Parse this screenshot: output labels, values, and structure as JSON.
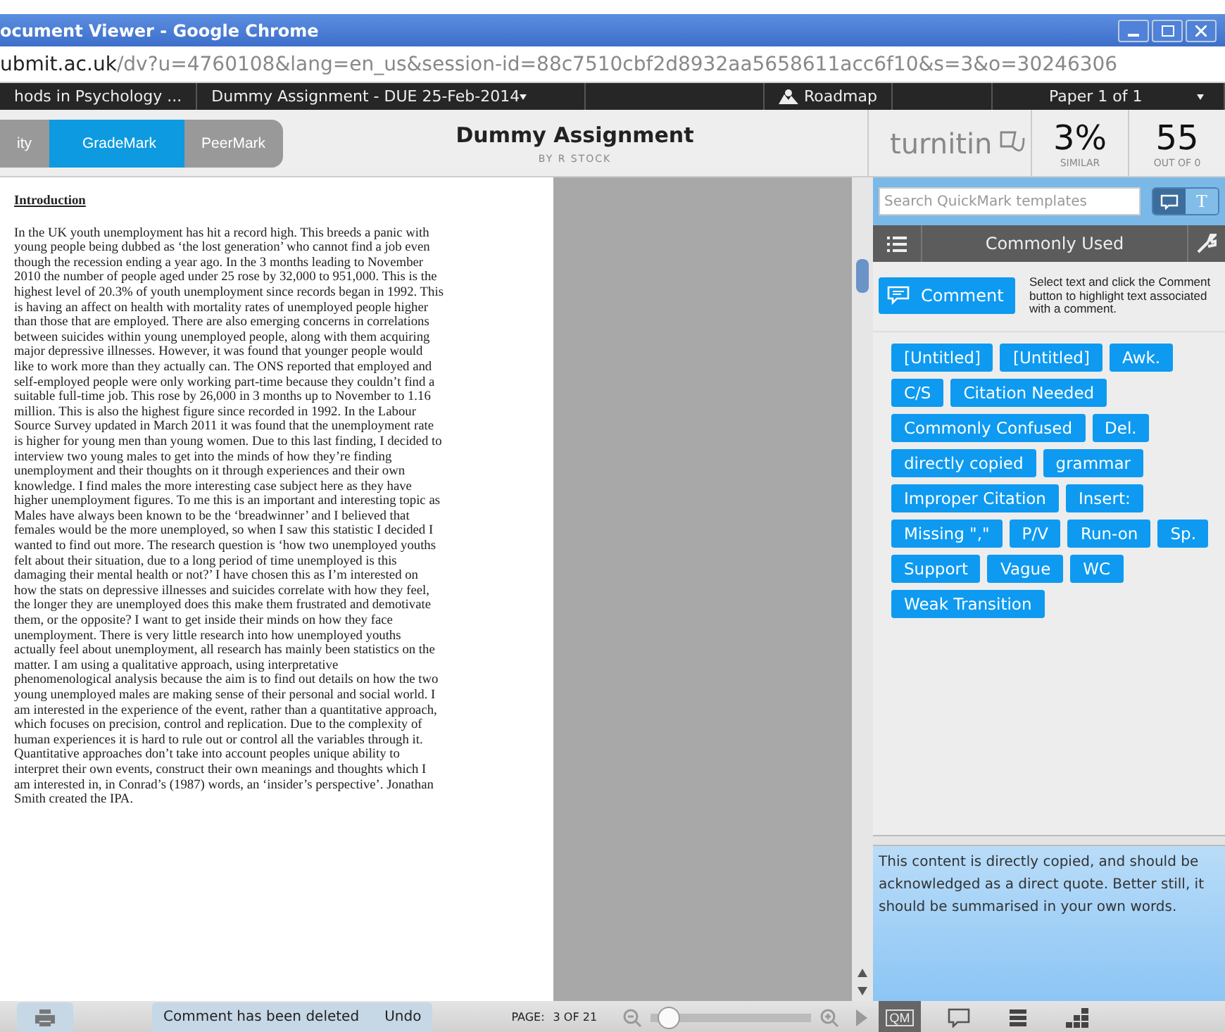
{
  "window": {
    "title": "ocument Viewer - Google Chrome"
  },
  "address": {
    "host": "ubmit.ac.uk",
    "path": "/dv?u=4760108&lang=en_us&session-id=88c7510cbf2d8932aa5658611acc6f10&s=3&o=30246306"
  },
  "nav": {
    "class": "hods in Psychology ...",
    "assignment": "Dummy Assignment - DUE 25-Feb-2014",
    "roadmap": "Roadmap",
    "paper": "Paper 1 of 1"
  },
  "modes": [
    {
      "label": "ity",
      "selected": false
    },
    {
      "label": "GradeMark",
      "selected": true
    },
    {
      "label": "PeerMark",
      "selected": false
    }
  ],
  "header": {
    "title": "Dummy Assignment",
    "author": "BY R STOCK",
    "brand": "turnitin",
    "similarity": "3%",
    "similarity_label": "SIMILAR",
    "score": "55",
    "score_label": "OUT OF 0"
  },
  "document": {
    "heading": "Introduction",
    "lines": [
      "In the UK youth unemployment has hit a record high. This breeds a panic with",
      "young people being dubbed as ‘the lost generation’ who cannot find a job even",
      "though the recession ending a year ago.  In the 3 months leading to November",
      "2010 the number of people aged under 25 rose by 32,000 to 951,000. This is the",
      "highest level of 20.3% of youth unemployment since records began in 1992. This",
      "is having an affect on health with mortality rates of unemployed people higher",
      "than those that are employed. There are also emerging concerns in correlations",
      "between suicides within young unemployed people, along with them acquiring",
      "major depressive illnesses. However, it was found that younger people would",
      "like to work more than they actually can. The ONS reported that employed and",
      "self-employed people were only working part-time because they couldn’t find a",
      "suitable full-time job. This rose by 26,000 in 3 months up to November to 1.16",
      "million. This is also the highest figure since recorded in 1992. In the Labour",
      "Source Survey updated in March 2011 it was found that the unemployment rate",
      "is higher for young men than young women. Due to this last finding, I decided to",
      "interview two young males to get into the minds of how they’re finding",
      "unemployment and their thoughts on it through experiences and their own",
      "knowledge. I find males the more interesting case subject here as they have",
      "higher unemployment figures. To me this is an important and interesting topic as",
      "Males have always been known to be the ‘breadwinner’ and I believed that",
      "females would be the more unemployed, so when I saw this statistic I decided I",
      "wanted to find out more. The research question is ‘how two unemployed youths",
      "felt about their situation, due to a long period of time unemployed is this",
      "damaging their mental health or not?’ I have chosen this as I’m interested on",
      "how the stats on depressive illnesses and suicides correlate with how they feel,",
      "the longer they are unemployed does this make them frustrated and demotivate",
      "them, or the opposite? I want to get inside their minds on how they face",
      "unemployment. There is very little research into how unemployed youths",
      "actually feel about unemployment, all research has mainly been statistics on the",
      "matter.  I am using a qualitative approach, using interpretative",
      "phenomenological analysis because the aim is to find out details on how the two",
      "young unemployed males are making sense of their personal and social world. I",
      "am interested in the experience of the event, rather than a quantitative approach,",
      "which focuses on precision, control and replication. Due to the complexity of",
      "human experiences it is hard to rule out or control all the variables through it.",
      "Quantitative approaches don’t take into account peoples unique ability to",
      "interpret their own events, construct their own meanings and thoughts which I",
      "am interested in, in Conrad’s (1987) words, an ‘insider’s perspective’. Jonathan",
      "Smith created the IPA."
    ]
  },
  "quickmark": {
    "search": {
      "placeholder": "Search QuickMark templates"
    },
    "view_tabs": [
      {
        "kind": "comment",
        "selected": true
      },
      {
        "kind": "text",
        "label": "T",
        "selected": false
      }
    ],
    "set": "Commonly Used",
    "comment_button": "Comment",
    "hint": "Select text and click the Comment button to highlight text associated with a comment.",
    "tags": [
      "[Untitled]",
      "[Untitled]",
      "Awk.",
      "C/S",
      "Citation Needed",
      "Commonly Confused",
      "Del.",
      "directly copied",
      "grammar",
      "Improper Citation",
      "Insert:",
      "Missing \",\"",
      "P/V",
      "Run-on",
      "Sp.",
      "Support",
      "Vague",
      "WC",
      "Weak Transition"
    ],
    "description": "This content is directly copied, and should be acknowledged as a direct quote. Better still, it should be summarised in your own words."
  },
  "status": {
    "message": "Comment has been deleted",
    "undo": "Undo",
    "page_label": "PAGE:",
    "page": "3 OF 21",
    "zoom": {
      "level": 0.05
    }
  },
  "panel_tabs": [
    {
      "kind": "qm",
      "label": "QM",
      "selected": true
    },
    {
      "kind": "comments",
      "selected": false
    },
    {
      "kind": "list",
      "selected": false
    },
    {
      "kind": "grid",
      "selected": false
    }
  ]
}
